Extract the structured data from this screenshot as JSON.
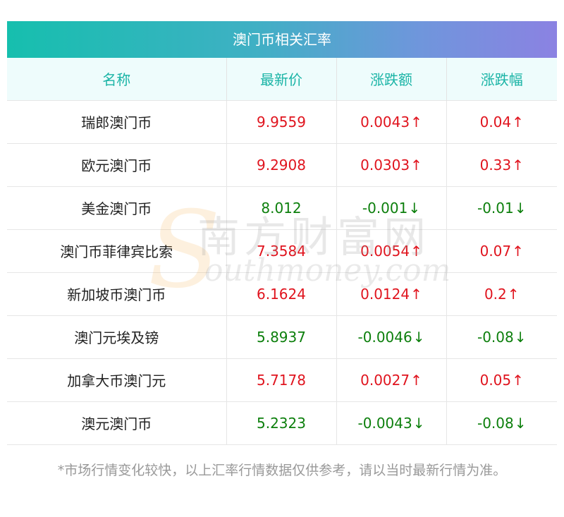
{
  "title": "澳门币相关汇率",
  "headers": [
    "名称",
    "最新价",
    "涨跌额",
    "涨跌幅"
  ],
  "arrows": {
    "up": "↑",
    "down": "↓"
  },
  "colors": {
    "up": "#e0141e",
    "down": "#0c7f0c",
    "header_text": "#1ab4a6"
  },
  "rows": [
    {
      "name": "瑞郎澳门币",
      "price": "9.9559",
      "change": "0.0043",
      "percent": "0.04",
      "dir": "up"
    },
    {
      "name": "欧元澳门币",
      "price": "9.2908",
      "change": "0.0303",
      "percent": "0.33",
      "dir": "up"
    },
    {
      "name": "美金澳门币",
      "price": "8.012",
      "change": "-0.001",
      "percent": "-0.01",
      "dir": "down"
    },
    {
      "name": "澳门币菲律宾比索",
      "price": "7.3584",
      "change": "0.0054",
      "percent": "0.07",
      "dir": "up"
    },
    {
      "name": "新加坡币澳门币",
      "price": "6.1624",
      "change": "0.0124",
      "percent": "0.2",
      "dir": "up"
    },
    {
      "name": "澳门元埃及镑",
      "price": "5.8937",
      "change": "-0.0046",
      "percent": "-0.08",
      "dir": "down"
    },
    {
      "name": "加拿大币澳门元",
      "price": "5.7178",
      "change": "0.0027",
      "percent": "0.05",
      "dir": "up"
    },
    {
      "name": "澳元澳门币",
      "price": "5.2323",
      "change": "-0.0043",
      "percent": "-0.08",
      "dir": "down"
    }
  ],
  "note": "*市场行情变化较快，以上汇率行情数据仅供参考，请以当时最新行情为准。",
  "watermark": {
    "s": "S",
    "cn": "南方财富网",
    "en": "outhmoney.com"
  }
}
